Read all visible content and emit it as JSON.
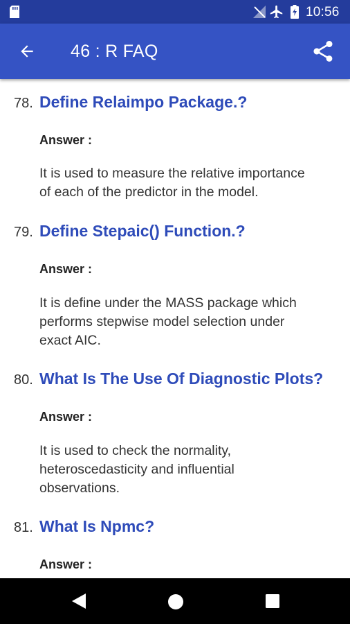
{
  "status_bar": {
    "time": "10:56",
    "icons": [
      "sd-card-icon",
      "no-signal-icon",
      "airplane-mode-icon",
      "battery-charging-icon"
    ]
  },
  "app_bar": {
    "title": "46 : R FAQ",
    "back_icon": "arrow-back-icon",
    "share_icon": "share-icon"
  },
  "questions": [
    {
      "number": "78.",
      "question": "Define Relaimpo Package.?",
      "answer_label": "Answer :",
      "answer_lines": [
        "It is used to measure the relative importance",
        "of each of the predictor in the model."
      ]
    },
    {
      "number": "79.",
      "question": "Define Stepaic() Function.?",
      "answer_label": "Answer :",
      "answer_lines": [
        "It is define under the MASS package which",
        "performs stepwise model selection under",
        "exact AIC."
      ]
    },
    {
      "number": "80.",
      "question": "What Is The Use Of Diagnostic Plots?",
      "answer_label": "Answer :",
      "answer_lines": [
        "It is used to check the normality,",
        "heteroscedasticity and influential",
        "observations."
      ]
    },
    {
      "number": "81.",
      "question": "What Is Npmc?",
      "answer_label": "Answer :",
      "answer_lines": []
    }
  ],
  "nav_bar": {
    "icons": [
      "nav-back-icon",
      "nav-home-icon",
      "nav-recents-icon"
    ]
  },
  "colors": {
    "status_bar": "#243c9c",
    "app_bar": "#3553c4",
    "question_text": "#2e4bb9"
  }
}
